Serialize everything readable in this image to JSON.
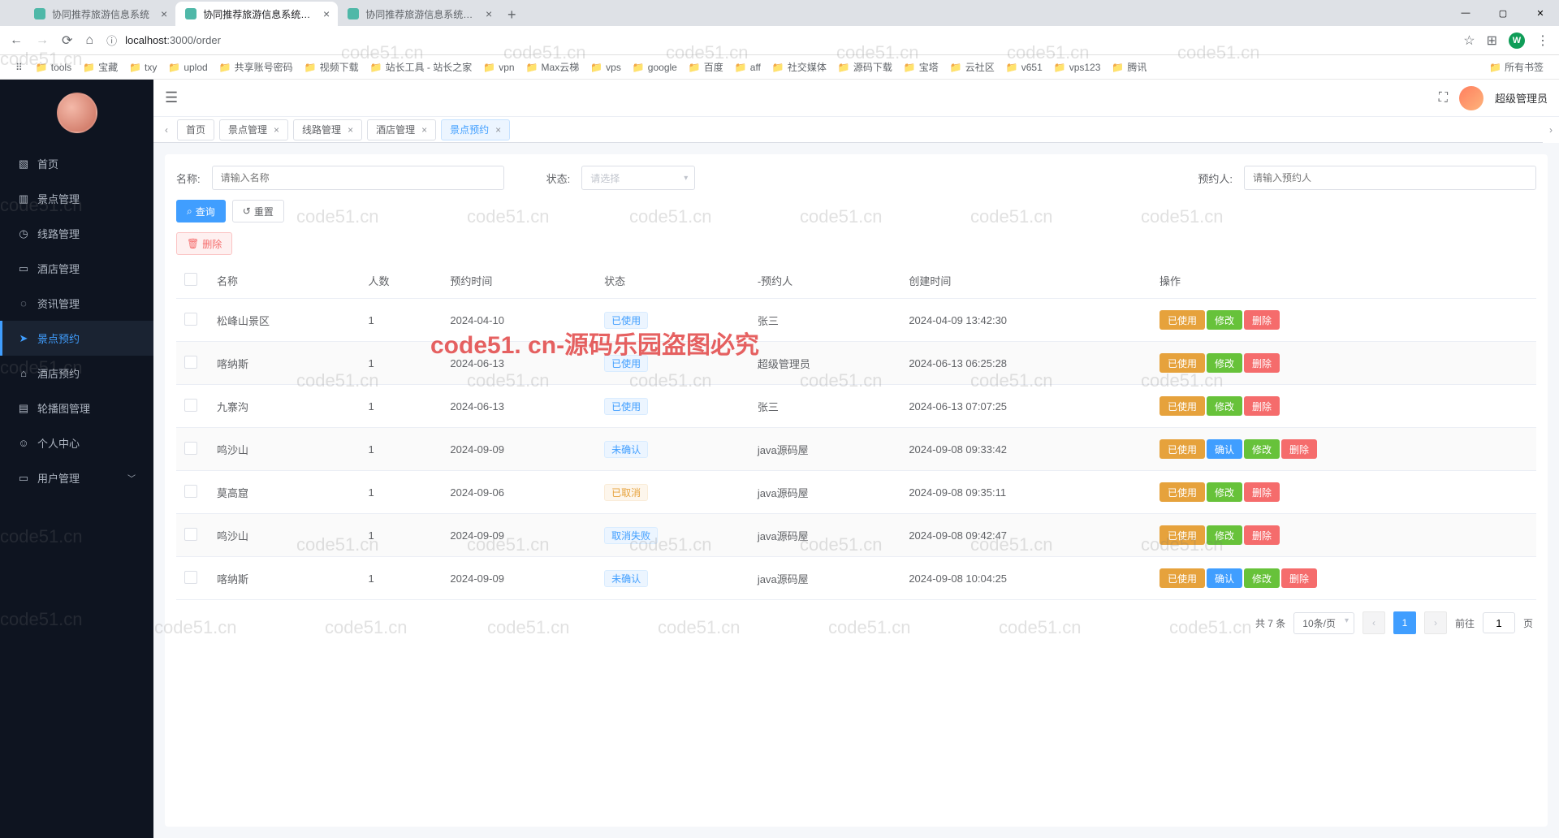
{
  "browser": {
    "tabs": [
      {
        "title": "协同推荐旅游信息系统",
        "active": false
      },
      {
        "title": "协同推荐旅游信息系统后台",
        "active": true
      },
      {
        "title": "协同推荐旅游信息系统后台",
        "active": false
      }
    ],
    "url_host": "localhost",
    "url_port_path": ":3000/order",
    "bookmarks": [
      "tools",
      "宝藏",
      "txy",
      "uplod",
      "共享账号密码",
      "视频下载",
      "站长工具 - 站长之家",
      "vpn",
      "Max云梯",
      "vps",
      "google",
      "百度",
      "aff",
      "社交媒体",
      "源码下载",
      "宝塔",
      "云社区",
      "v651",
      "vps123",
      "腾讯"
    ],
    "all_bookmarks": "所有书签",
    "ext_badge": "W"
  },
  "header": {
    "user_name": "超级管理员"
  },
  "sidebar": {
    "items": [
      {
        "icon": "▧",
        "label": "首页"
      },
      {
        "icon": "▥",
        "label": "景点管理"
      },
      {
        "icon": "◷",
        "label": "线路管理"
      },
      {
        "icon": "▭",
        "label": "酒店管理"
      },
      {
        "icon": "◌",
        "label": "资讯管理"
      },
      {
        "icon": "➤",
        "label": "景点预约",
        "active": true
      },
      {
        "icon": "⌂",
        "label": "酒店预约"
      },
      {
        "icon": "▤",
        "label": "轮播图管理"
      },
      {
        "icon": "☺",
        "label": "个人中心"
      },
      {
        "icon": "▭",
        "label": "用户管理",
        "expandable": true
      }
    ]
  },
  "page_tabs": [
    {
      "label": "首页",
      "closable": false
    },
    {
      "label": "景点管理",
      "closable": true
    },
    {
      "label": "线路管理",
      "closable": true
    },
    {
      "label": "酒店管理",
      "closable": true
    },
    {
      "label": "景点预约",
      "closable": true,
      "active": true
    }
  ],
  "filters": {
    "name_label": "名称:",
    "name_placeholder": "请输入名称",
    "status_label": "状态:",
    "status_placeholder": "请选择",
    "booker_label": "预约人:",
    "booker_placeholder": "请输入预约人",
    "search_btn": "查询",
    "reset_btn": "重置",
    "delete_btn": "删除"
  },
  "table": {
    "columns": [
      "名称",
      "人数",
      "预约时间",
      "状态",
      "-预约人",
      "创建时间",
      "操作"
    ],
    "rows": [
      {
        "name": "松峰山景区",
        "count": "1",
        "book_time": "2024-04-10",
        "status": "已使用",
        "status_color": "blue",
        "booker": "张三",
        "created": "2024-04-09 13:42:30",
        "ops": [
          "已使用",
          "修改",
          "删除"
        ],
        "op_colors": [
          "orange",
          "green",
          "red"
        ]
      },
      {
        "name": "喀纳斯",
        "count": "1",
        "book_time": "2024-06-13",
        "status": "已使用",
        "status_color": "blue",
        "booker": "超级管理员",
        "created": "2024-06-13 06:25:28",
        "ops": [
          "已使用",
          "修改",
          "删除"
        ],
        "op_colors": [
          "orange",
          "green",
          "red"
        ]
      },
      {
        "name": "九寨沟",
        "count": "1",
        "book_time": "2024-06-13",
        "status": "已使用",
        "status_color": "blue",
        "booker": "张三",
        "created": "2024-06-13 07:07:25",
        "ops": [
          "已使用",
          "修改",
          "删除"
        ],
        "op_colors": [
          "orange",
          "green",
          "red"
        ]
      },
      {
        "name": "鸣沙山",
        "count": "1",
        "book_time": "2024-09-09",
        "status": "未确认",
        "status_color": "blue",
        "booker": "java源码屋",
        "created": "2024-09-08 09:33:42",
        "ops": [
          "已使用",
          "确认",
          "修改",
          "删除"
        ],
        "op_colors": [
          "orange",
          "blue",
          "green",
          "red"
        ]
      },
      {
        "name": "莫高窟",
        "count": "1",
        "book_time": "2024-09-06",
        "status": "已取消",
        "status_color": "orange",
        "booker": "java源码屋",
        "created": "2024-09-08 09:35:11",
        "ops": [
          "已使用",
          "修改",
          "删除"
        ],
        "op_colors": [
          "orange",
          "green",
          "red"
        ]
      },
      {
        "name": "鸣沙山",
        "count": "1",
        "book_time": "2024-09-09",
        "status": "取消失败",
        "status_color": "blue",
        "booker": "java源码屋",
        "created": "2024-09-08 09:42:47",
        "ops": [
          "已使用",
          "修改",
          "删除"
        ],
        "op_colors": [
          "orange",
          "green",
          "red"
        ]
      },
      {
        "name": "喀纳斯",
        "count": "1",
        "book_time": "2024-09-09",
        "status": "未确认",
        "status_color": "blue",
        "booker": "java源码屋",
        "created": "2024-09-08 10:04:25",
        "ops": [
          "已使用",
          "确认",
          "修改",
          "删除"
        ],
        "op_colors": [
          "orange",
          "blue",
          "green",
          "red"
        ]
      }
    ]
  },
  "pagination": {
    "total_label": "共 7 条",
    "page_size": "10条/页",
    "current": "1",
    "goto_prefix": "前往",
    "goto_value": "1",
    "goto_suffix": "页"
  },
  "watermark": {
    "small": "code51.cn",
    "big": "code51. cn-源码乐园盗图必究"
  }
}
